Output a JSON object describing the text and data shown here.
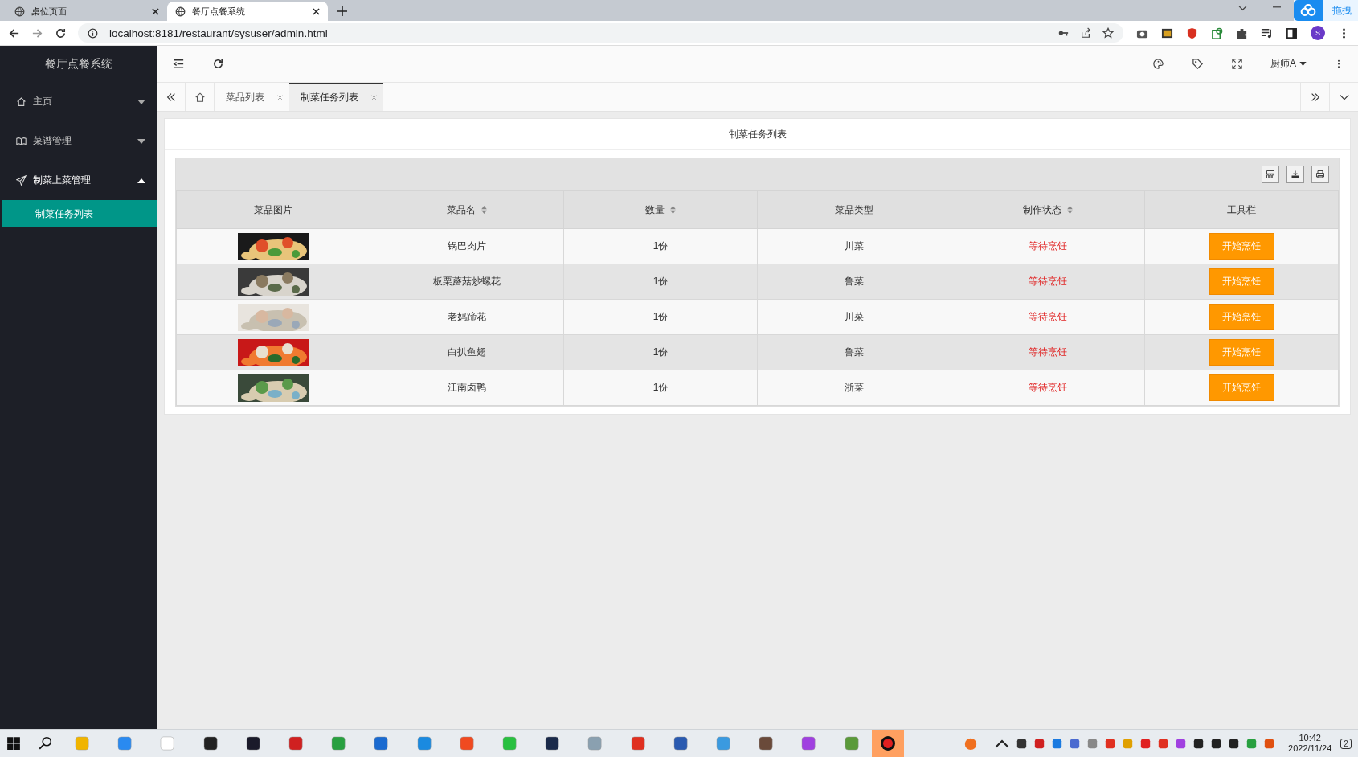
{
  "browser": {
    "tabs": [
      {
        "title": "桌位页面",
        "selected": false
      },
      {
        "title": "餐厅点餐系统",
        "selected": true
      }
    ],
    "url": "localhost:8181/restaurant/sysuser/admin.html",
    "extension_label": "拖拽",
    "profile_initial": "S"
  },
  "sidebar": {
    "title": "餐厅点餐系统",
    "items": [
      {
        "label": "主页",
        "kind": "home",
        "expanded": false
      },
      {
        "label": "菜谱管理",
        "kind": "book",
        "expanded": false
      },
      {
        "label": "制菜上菜管理",
        "kind": "send",
        "expanded": true,
        "children": [
          {
            "label": "制菜任务列表",
            "selected": true
          }
        ]
      }
    ]
  },
  "header": {
    "user": "厨师A"
  },
  "page_tabs": [
    {
      "label": "菜品列表",
      "selected": false
    },
    {
      "label": "制菜任务列表",
      "selected": true
    }
  ],
  "panel": {
    "title": "制菜任务列表",
    "table": {
      "columns": [
        {
          "label": "菜品图片",
          "sortable": false
        },
        {
          "label": "菜品名",
          "sortable": true
        },
        {
          "label": "数量",
          "sortable": true
        },
        {
          "label": "菜品类型",
          "sortable": false
        },
        {
          "label": "制作状态",
          "sortable": true
        },
        {
          "label": "工具栏",
          "sortable": false
        }
      ],
      "rows": [
        {
          "name": "锅巴肉片",
          "quantity": "1份",
          "type": "川菜",
          "status": "等待烹饪",
          "action": "开始烹饪"
        },
        {
          "name": "板栗蘑菇炒螺花",
          "quantity": "1份",
          "type": "鲁菜",
          "status": "等待烹饪",
          "action": "开始烹饪"
        },
        {
          "name": "老妈蹄花",
          "quantity": "1份",
          "type": "川菜",
          "status": "等待烹饪",
          "action": "开始烹饪"
        },
        {
          "name": "白扒鱼翅",
          "quantity": "1份",
          "type": "鲁菜",
          "status": "等待烹饪",
          "action": "开始烹饪"
        },
        {
          "name": "江南卤鸭",
          "quantity": "1份",
          "type": "浙菜",
          "status": "等待烹饪",
          "action": "开始烹饪"
        }
      ]
    }
  },
  "taskbar": {
    "time": "10:42",
    "date": "2022/11/24",
    "notifications": "2"
  }
}
